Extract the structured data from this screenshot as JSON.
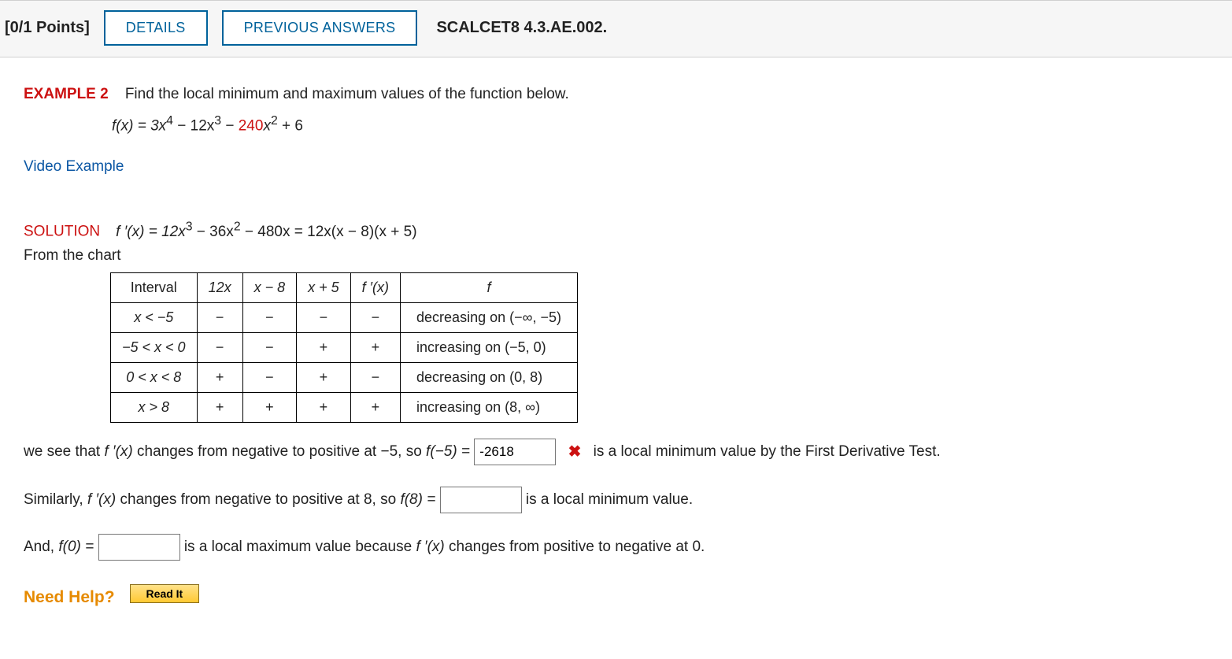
{
  "header": {
    "points": "[0/1 Points]",
    "details": "DETAILS",
    "previous": "PREVIOUS ANSWERS",
    "ref": "SCALCET8 4.3.AE.002."
  },
  "example_label": "EXAMPLE 2",
  "prompt": "Find the local minimum and maximum values of the function below.",
  "fx": {
    "prefix": "f(x) = 3x",
    "e1": "4",
    "mid1": " − 12x",
    "e2": "3",
    "mid2": " − ",
    "coef_red": "240",
    "tail": "x",
    "e3": "2",
    "plus": " + 6"
  },
  "video_link": "Video Example",
  "solution_label": "SOLUTION",
  "sol_eq": {
    "a": "f ′(x) = 12x",
    "e1": "3",
    "b": " − 36x",
    "e2": "2",
    "c": " − 480x = 12x(x − 8)(x + 5)"
  },
  "from_chart": "From the chart",
  "chart_data": {
    "type": "table",
    "headers": [
      "Interval",
      "12x",
      "x − 8",
      "x + 5",
      "f ′(x)",
      "f"
    ],
    "rows": [
      {
        "interval": "x < −5",
        "signs": [
          "−",
          "−",
          "−",
          "−"
        ],
        "desc": "decreasing on  (−∞, −5)"
      },
      {
        "interval": "−5 < x < 0",
        "signs": [
          "−",
          "−",
          "+",
          "+"
        ],
        "desc": "increasing on  (−5, 0)"
      },
      {
        "interval": "0 < x < 8",
        "signs": [
          "+",
          "−",
          "+",
          "−"
        ],
        "desc": "decreasing on  (0, 8)"
      },
      {
        "interval": "x > 8",
        "signs": [
          "+",
          "+",
          "+",
          "+"
        ],
        "desc": "increasing on  (8, ∞)"
      }
    ]
  },
  "sentence1": {
    "a": "we see that  ",
    "fp": "f ′(x)",
    "b": "  changes from negative to positive at  −5,  so  ",
    "feq": "f(−5) = ",
    "ans1": "-2618",
    "wrong": "✖",
    "c": "is a local minimum value by the First Derivative Test."
  },
  "sentence2": {
    "a": "Similarly,  ",
    "fp": "f ′(x)",
    "b": "  changes from negative to positive at 8, so  ",
    "feq": "f(8) = ",
    "ans2": "",
    "c": "  is a local minimum value."
  },
  "sentence3": {
    "a": "And,  ",
    "feq": "f(0) = ",
    "ans3": "",
    "b": "  is a local maximum value because  ",
    "fp": "f ′(x)",
    "c": "  changes from positive to negative at 0."
  },
  "need_help": "Need Help?",
  "read_it": "Read It"
}
